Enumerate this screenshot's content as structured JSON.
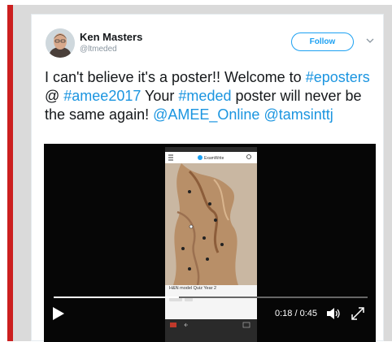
{
  "tweet": {
    "author_name": "Ken Masters",
    "author_handle": "@ltmeded",
    "follow_label": "Follow",
    "text_parts": [
      {
        "text": "I can't believe it's a poster!! Welcome to ",
        "link": false
      },
      {
        "text": "#eposters",
        "link": true
      },
      {
        "text": " @ ",
        "link": false
      },
      {
        "text": "#amee2017",
        "link": true
      },
      {
        "text": " Your ",
        "link": false
      },
      {
        "text": "#meded",
        "link": true
      },
      {
        "text": " poster will never be the same again! ",
        "link": false
      },
      {
        "text": "@AMEE_Online",
        "link": true
      },
      {
        "text": " ",
        "link": false
      },
      {
        "text": "@tamsinttj",
        "link": true
      }
    ]
  },
  "video": {
    "phone_app": "ExamWrite",
    "phone_caption": "H&N model Quiz Year 2",
    "time": "0:18 / 0:45",
    "progress": 0.4
  },
  "colors": {
    "accent": "#1da1f2",
    "link": "#1b95e0",
    "red_bar": "#cc1f1f"
  }
}
